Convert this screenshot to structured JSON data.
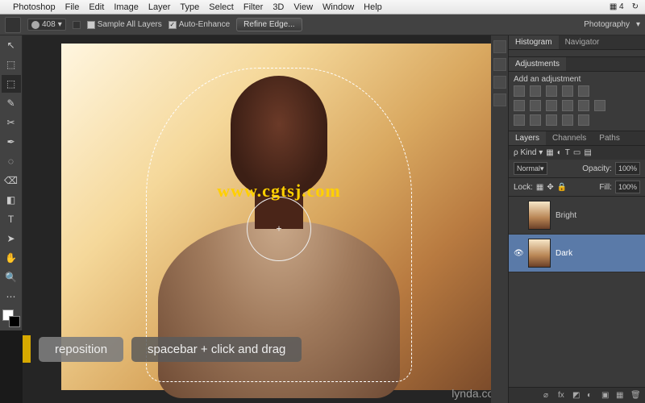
{
  "mac_menu": {
    "apple": "",
    "items": [
      "Photoshop",
      "File",
      "Edit",
      "Image",
      "Layer",
      "Type",
      "Select",
      "Filter",
      "3D",
      "View",
      "Window",
      "Help"
    ],
    "right": [
      "4",
      "↻"
    ]
  },
  "options_bar": {
    "brush_size": "408",
    "sample_all_label": "Sample All Layers",
    "auto_enhance_label": "Auto-Enhance",
    "refine_label": "Refine Edge...",
    "workspace": "Photography"
  },
  "toolbox_icons": [
    "↖",
    "⬚",
    "⬚",
    "✎",
    "✂",
    "✒",
    "◌",
    "⌫",
    "◧",
    "T",
    "➤",
    "✋",
    "🔍",
    "⋯"
  ],
  "canvas": {
    "watermark": "www.cgtsj.com"
  },
  "tip": {
    "label": "reposition",
    "shortcut": "spacebar + click and drag"
  },
  "brand": "lynda.com",
  "panels": {
    "histogram_tabs": [
      "Histogram",
      "Navigator"
    ],
    "adjustments_tab": "Adjustments",
    "add_adjustment": "Add an adjustment",
    "layers_tabs": [
      "Layers",
      "Channels",
      "Paths"
    ],
    "kind_label": "Kind",
    "blend_mode": "Normal",
    "opacity_label": "Opacity:",
    "opacity_value": "100%",
    "lock_label": "Lock:",
    "fill_label": "Fill:",
    "fill_value": "100%",
    "layers": [
      {
        "name": "Bright",
        "visible": false,
        "active": false
      },
      {
        "name": "Dark",
        "visible": true,
        "active": true
      }
    ]
  }
}
